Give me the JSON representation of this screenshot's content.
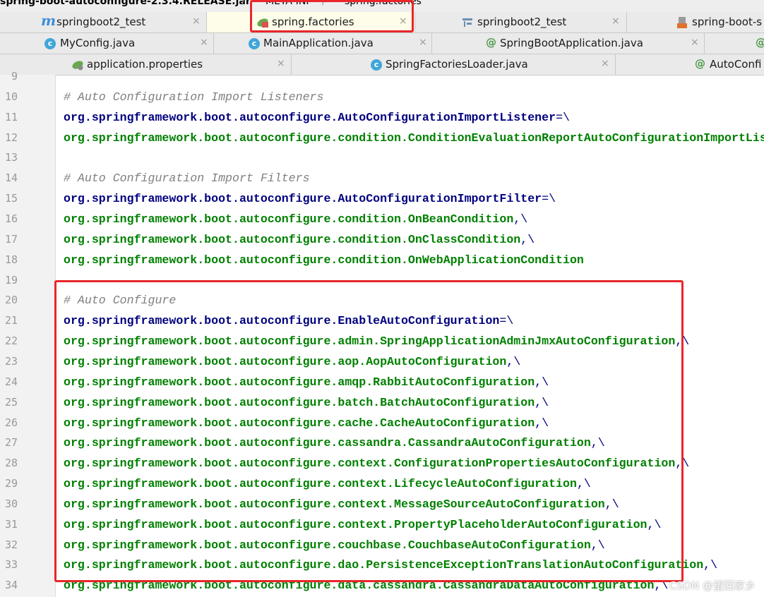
{
  "breadcrumb": {
    "jar": "spring-boot-autoconfigure-2.3.4.RELEASE.jar",
    "separator": "/",
    "folder": "META-INF",
    "file": "spring.factories"
  },
  "tab_rows": [
    [
      {
        "label": "springboot2_test",
        "icon": "module-m-icon",
        "active": false,
        "closable": true
      },
      {
        "label": "spring.factories",
        "icon": "spring-leaf-icon",
        "active": true,
        "closable": true
      },
      {
        "label": "springboot2_test",
        "icon": "structure-icon",
        "active": false,
        "closable": true
      },
      {
        "label": "spring-boot-s",
        "icon": "xml-file-icon",
        "active": false,
        "closable": false
      }
    ],
    [
      {
        "label": "MyConfig.java",
        "icon": "class-c-icon",
        "active": false,
        "closable": true
      },
      {
        "label": "MainApplication.java",
        "icon": "class-c-icon",
        "active": false,
        "closable": true
      },
      {
        "label": "SpringBootApplication.java",
        "icon": "annotation-icon",
        "active": false,
        "closable": true
      },
      {
        "label": "",
        "icon": "annotation-icon",
        "active": false,
        "closable": false
      }
    ],
    [
      {
        "label": "application.properties",
        "icon": "spring-leaf-icon",
        "active": false,
        "closable": true
      },
      {
        "label": "SpringFactoriesLoader.java",
        "icon": "class-c-icon",
        "active": false,
        "closable": true
      },
      {
        "label": "AutoConfi",
        "icon": "annotation-icon",
        "active": false,
        "closable": false
      }
    ]
  ],
  "close_glyph": "×",
  "lines": [
    {
      "n": "9",
      "kind": "blank",
      "text": ""
    },
    {
      "n": "10",
      "kind": "comment",
      "text": "# Auto Configuration Import Listeners"
    },
    {
      "n": "11",
      "kind": "key",
      "text": "org.springframework.boot.autoconfigure.AutoConfigurationImportListener",
      "tail": "=\\"
    },
    {
      "n": "12",
      "kind": "value",
      "text": "org.springframework.boot.autoconfigure.condition.ConditionEvaluationReportAutoConfigurationImportListener",
      "tail": ""
    },
    {
      "n": "13",
      "kind": "blank",
      "text": ""
    },
    {
      "n": "14",
      "kind": "comment",
      "text": "# Auto Configuration Import Filters"
    },
    {
      "n": "15",
      "kind": "key",
      "text": "org.springframework.boot.autoconfigure.AutoConfigurationImportFilter",
      "tail": "=\\"
    },
    {
      "n": "16",
      "kind": "value",
      "text": "org.springframework.boot.autoconfigure.condition.OnBeanCondition",
      "tail": ",\\"
    },
    {
      "n": "17",
      "kind": "value",
      "text": "org.springframework.boot.autoconfigure.condition.OnClassCondition",
      "tail": ",\\"
    },
    {
      "n": "18",
      "kind": "value",
      "text": "org.springframework.boot.autoconfigure.condition.OnWebApplicationCondition",
      "tail": ""
    },
    {
      "n": "19",
      "kind": "blank",
      "text": ""
    },
    {
      "n": "20",
      "kind": "comment",
      "text": "# Auto Configure"
    },
    {
      "n": "21",
      "kind": "key",
      "text": "org.springframework.boot.autoconfigure.EnableAutoConfiguration",
      "tail": "=\\"
    },
    {
      "n": "22",
      "kind": "value",
      "text": "org.springframework.boot.autoconfigure.admin.SpringApplicationAdminJmxAutoConfiguration",
      "tail": ",\\"
    },
    {
      "n": "23",
      "kind": "value",
      "text": "org.springframework.boot.autoconfigure.aop.AopAutoConfiguration",
      "tail": ",\\"
    },
    {
      "n": "24",
      "kind": "value",
      "text": "org.springframework.boot.autoconfigure.amqp.RabbitAutoConfiguration",
      "tail": ",\\"
    },
    {
      "n": "25",
      "kind": "value",
      "text": "org.springframework.boot.autoconfigure.batch.BatchAutoConfiguration",
      "tail": ",\\"
    },
    {
      "n": "26",
      "kind": "value",
      "text": "org.springframework.boot.autoconfigure.cache.CacheAutoConfiguration",
      "tail": ",\\"
    },
    {
      "n": "27",
      "kind": "value",
      "text": "org.springframework.boot.autoconfigure.cassandra.CassandraAutoConfiguration",
      "tail": ",\\"
    },
    {
      "n": "28",
      "kind": "value",
      "text": "org.springframework.boot.autoconfigure.context.ConfigurationPropertiesAutoConfiguration",
      "tail": ",\\"
    },
    {
      "n": "29",
      "kind": "value",
      "text": "org.springframework.boot.autoconfigure.context.LifecycleAutoConfiguration",
      "tail": ",\\"
    },
    {
      "n": "30",
      "kind": "value",
      "text": "org.springframework.boot.autoconfigure.context.MessageSourceAutoConfiguration",
      "tail": ",\\"
    },
    {
      "n": "31",
      "kind": "value",
      "text": "org.springframework.boot.autoconfigure.context.PropertyPlaceholderAutoConfiguration",
      "tail": ",\\"
    },
    {
      "n": "32",
      "kind": "value",
      "text": "org.springframework.boot.autoconfigure.couchbase.CouchbaseAutoConfiguration",
      "tail": ",\\"
    },
    {
      "n": "33",
      "kind": "value",
      "text": "org.springframework.boot.autoconfigure.dao.PersistenceExceptionTranslationAutoConfiguration",
      "tail": ",\\"
    },
    {
      "n": "34",
      "kind": "value",
      "text": "org.springframework.boot.autoconfigure.data.cassandra.CassandraDataAutoConfiguration",
      "tail": ",\\"
    }
  ],
  "watermark": "CSDN @望回家乡",
  "colors": {
    "key": "#000080",
    "value": "#008000",
    "comment": "#808080",
    "highlight": "#e8262b",
    "active_tab": "#fdfde9"
  }
}
